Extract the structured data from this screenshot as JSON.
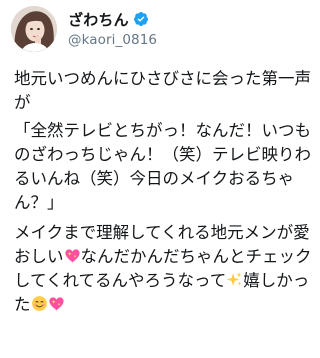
{
  "tweet": {
    "display_name": "ざわちん",
    "handle": "@kaori_0816",
    "paragraph1": "地元いつめんにひさびさに会った第一声が",
    "paragraph2": "「全然テレビとちがっ！なんだ！いつものざわっちじゃん！（笑）テレビ映りわるいんね（笑）今日のメイクおるちゃん？」",
    "paragraph3_part1": "メイクまで理解してくれる地元メンが愛おしい",
    "paragraph3_part2": "なんだかんだちゃんとチェックしてくれてるんやろうなって",
    "paragraph3_part3": "嬉しかった",
    "icons": {
      "verified": "verified-badge-icon",
      "heart": "sparkling-heart-emoji",
      "sparkles": "sparkles-emoji",
      "smile": "smiling-face-emoji"
    },
    "colors": {
      "verified_blue": "#1da1f2",
      "heart_pink": "#ff4fa0",
      "sparkle_yellow": "#ffc83d",
      "smile_yellow": "#ffcc4d"
    }
  }
}
